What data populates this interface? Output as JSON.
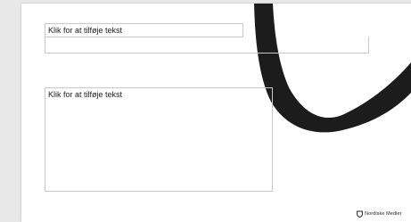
{
  "slide": {
    "title_placeholder": "Klik for at tilføje tekst",
    "subtitle_placeholder": "",
    "body_placeholder": "Klik for at tilføje tekst",
    "brand_text": "Nordiske Medier"
  },
  "colors": {
    "workspace": "#e8e8e8",
    "slide_bg": "#ffffff",
    "swoosh": "#1c1c1c",
    "placeholder_border": "#c8c8c8"
  },
  "icons": [
    "nordiske-medier-logo-icon"
  ]
}
